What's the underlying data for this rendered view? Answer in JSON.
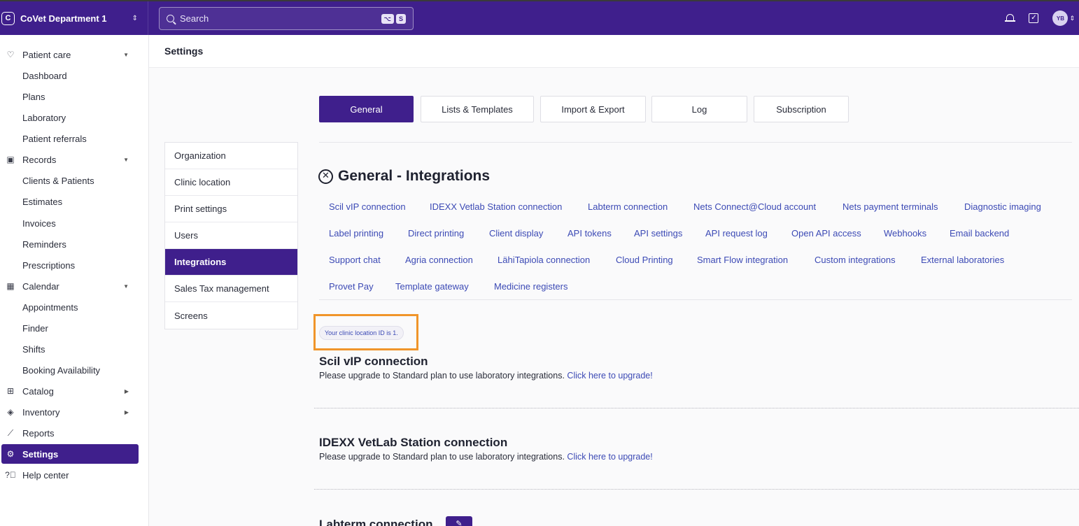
{
  "topbar": {
    "org_badge": "C",
    "org_name": "CoVet Department 1",
    "search_placeholder": "Search",
    "search_shortcut": [
      "⌥",
      "S"
    ],
    "avatar_initials": "YB"
  },
  "sidebar": {
    "items": [
      {
        "label": "Patient care",
        "icon": "heart-pulse-icon",
        "expandable": "down"
      },
      {
        "label": "Dashboard"
      },
      {
        "label": "Plans"
      },
      {
        "label": "Laboratory"
      },
      {
        "label": "Patient referrals"
      },
      {
        "label": "Records",
        "icon": "folder-icon",
        "expandable": "down"
      },
      {
        "label": "Clients & Patients"
      },
      {
        "label": "Estimates"
      },
      {
        "label": "Invoices"
      },
      {
        "label": "Reminders"
      },
      {
        "label": "Prescriptions"
      },
      {
        "label": "Calendar",
        "icon": "calendar-icon",
        "expandable": "down"
      },
      {
        "label": "Appointments"
      },
      {
        "label": "Finder"
      },
      {
        "label": "Shifts"
      },
      {
        "label": "Booking Availability"
      },
      {
        "label": "Catalog",
        "icon": "catalog-icon",
        "expandable": "right"
      },
      {
        "label": "Inventory",
        "icon": "box-icon",
        "expandable": "right"
      },
      {
        "label": "Reports",
        "icon": "chart-line-icon"
      },
      {
        "label": "Settings",
        "icon": "gear-icon",
        "active": true
      },
      {
        "label": "Help center",
        "icon": "help-icon"
      }
    ]
  },
  "page": {
    "title": "Settings"
  },
  "tabs": [
    {
      "label": "General",
      "active": true
    },
    {
      "label": "Lists & Templates"
    },
    {
      "label": "Import & Export"
    },
    {
      "label": "Log"
    },
    {
      "label": "Subscription"
    }
  ],
  "settings_menu": [
    {
      "label": "Organization"
    },
    {
      "label": "Clinic location"
    },
    {
      "label": "Print settings"
    },
    {
      "label": "Users"
    },
    {
      "label": "Integrations",
      "active": true
    },
    {
      "label": "Sales Tax management"
    },
    {
      "label": "Screens"
    }
  ],
  "section": {
    "title": "General - Integrations",
    "links": [
      "Scil vIP connection",
      "IDEXX Vetlab Station connection",
      "Labterm connection",
      "Nets Connect@Cloud account",
      "Nets payment terminals",
      "Diagnostic imaging",
      "Label printing",
      "Direct printing",
      "Client display",
      "API tokens",
      "API settings",
      "API request log",
      "Open API access",
      "Webhooks",
      "Email backend",
      "Support chat",
      "Agria connection",
      "LähiTapiola connection",
      "Cloud Printing",
      "Smart Flow integration",
      "Custom integrations",
      "External laboratories",
      "Provet Pay",
      "Template gateway",
      "Medicine registers"
    ],
    "clinic_id_text": "Your clinic location ID is 1."
  },
  "connections": [
    {
      "title": "Scil vIP connection",
      "text": "Please upgrade to Standard plan to use laboratory integrations.",
      "link": "Click here to upgrade!"
    },
    {
      "title": "IDEXX VetLab Station connection",
      "text": "Please upgrade to Standard plan to use laboratory integrations.",
      "link": "Click here to upgrade!"
    },
    {
      "title": "Labterm connection"
    }
  ],
  "colors": {
    "brand": "#3f1f8c",
    "link": "#3c4ab5",
    "highlight": "#f0952a"
  }
}
